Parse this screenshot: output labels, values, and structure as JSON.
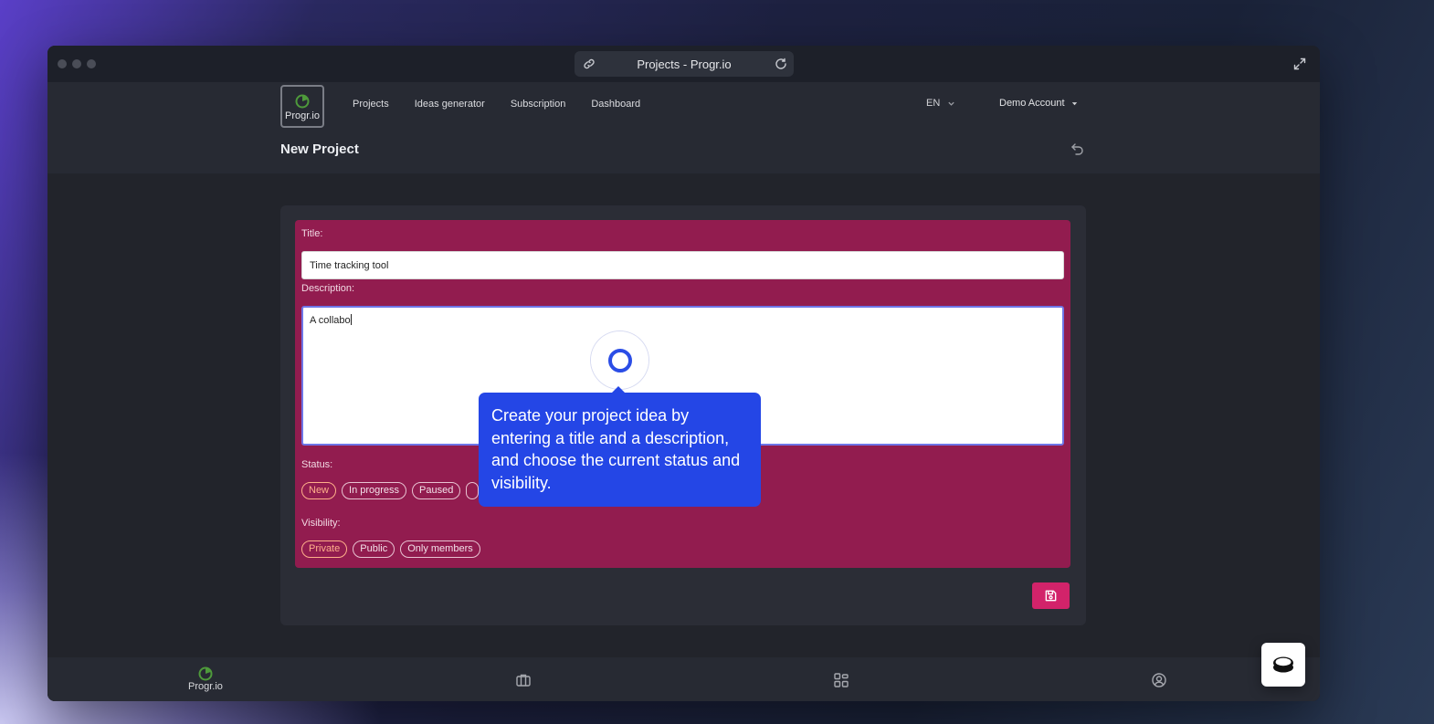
{
  "browser": {
    "url_title": "Projects - Progr.io"
  },
  "brand": {
    "name": "Progr.io"
  },
  "nav": {
    "links": [
      "Projects",
      "Ideas generator",
      "Subscription",
      "Dashboard"
    ],
    "language": "EN",
    "account": "Demo Account"
  },
  "page": {
    "title": "New Project"
  },
  "form": {
    "title_label": "Title:",
    "title_value": "Time tracking tool",
    "description_label": "Description:",
    "description_value": "A collabo",
    "status_label": "Status:",
    "status_options": [
      "New",
      "In progress",
      "Paused"
    ],
    "status_selected": "New",
    "visibility_label": "Visibility:",
    "visibility_options": [
      "Private",
      "Public",
      "Only members"
    ],
    "visibility_selected": "Private"
  },
  "tour": {
    "tooltip_text": "Create your project idea by entering a title and a description, and choose the current status and visibility."
  },
  "bottom_nav": {
    "home_label": "Progr.io"
  },
  "colors": {
    "form_bg": "#921c4f",
    "accent": "#d2236a",
    "tooltip_bg": "#2446e6",
    "active_pill": "#ffb08a"
  }
}
